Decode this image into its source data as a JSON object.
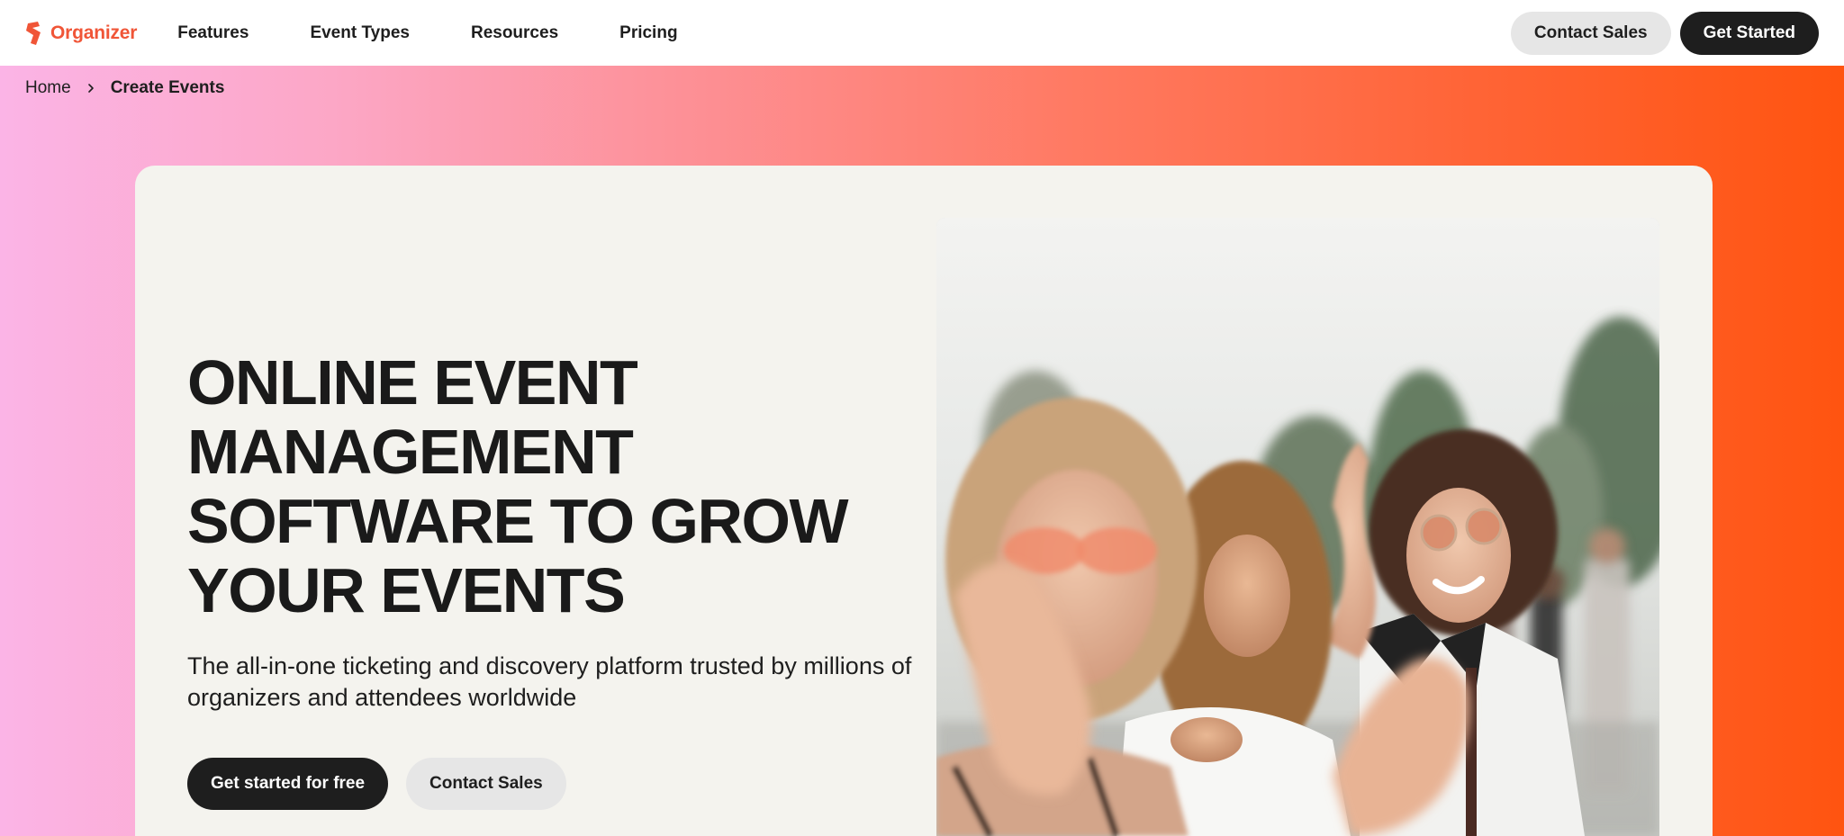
{
  "brand": {
    "name": "Organizer",
    "color": "#f05537",
    "icon": "organizer-logo-icon"
  },
  "nav": {
    "links": [
      "Features",
      "Event Types",
      "Resources",
      "Pricing"
    ],
    "contact_sales": "Contact Sales",
    "get_started": "Get Started"
  },
  "breadcrumb": {
    "home": "Home",
    "separator_icon": "chevron-right-icon",
    "current": "Create Events"
  },
  "hero": {
    "headline_lines": [
      "ONLINE EVENT",
      "MANAGEMENT",
      "SOFTWARE TO GROW",
      "YOUR EVENTS"
    ],
    "subhead_lines": [
      "The all-in-one ticketing and discovery platform trusted by millions of",
      "organizers and attendees worldwide"
    ],
    "primary_cta": "Get started for free",
    "secondary_cta": "Contact Sales",
    "image": "hero-photo-festival-crowd"
  },
  "colors": {
    "gradient_start": "#fbb4e6",
    "gradient_end": "#ff5410",
    "card_bg": "#f4f3ee",
    "dark_button": "#1e1e1e",
    "light_button": "#e6e6e6"
  }
}
